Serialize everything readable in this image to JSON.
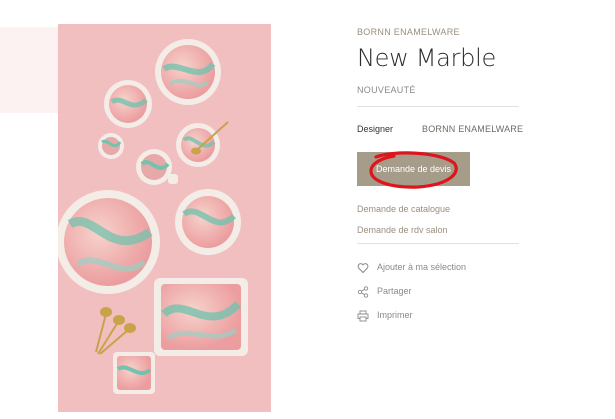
{
  "product": {
    "brand": "BORNN ENAMELWARE",
    "name": "New Marble",
    "badge": "NOUVEAUTÉ",
    "designer_label": "Designer",
    "designer_value": "BORNN ENAMELWARE"
  },
  "cta": {
    "quote_label": "Demande de devis"
  },
  "links": {
    "catalogue": "Demande de catalogue",
    "appointment": "Demande de rdv salon"
  },
  "actions": {
    "wishlist": "Ajouter à ma sélection",
    "share": "Partager",
    "print": "Imprimer"
  },
  "icons": {
    "wishlist": "heart-icon",
    "share": "share-icon",
    "print": "printer-icon"
  },
  "colors": {
    "button": "#a69c8a",
    "annotation": "#e0141c",
    "photo_background": "#f2bfc1"
  }
}
